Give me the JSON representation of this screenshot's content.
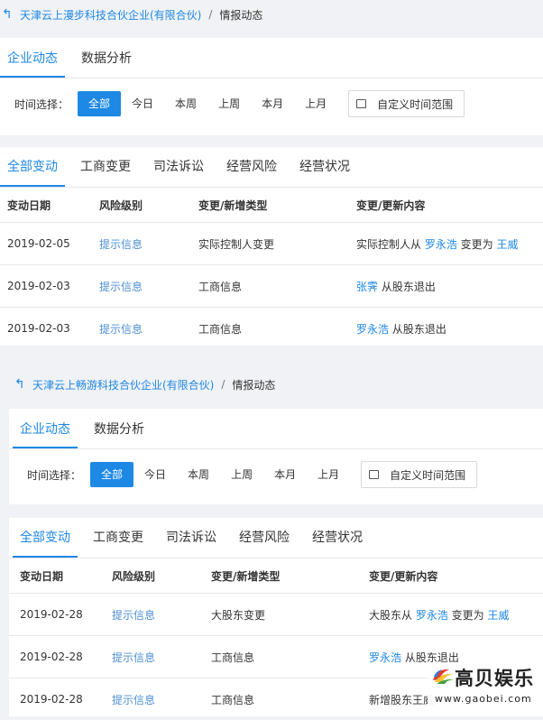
{
  "sections": [
    {
      "breadcrumb": {
        "company": "天津云上漫步科技合伙企业(有限合伙)",
        "separator": "/",
        "current": "情报动态"
      },
      "main_tabs": [
        {
          "label": "企业动态",
          "active": true
        },
        {
          "label": "数据分析",
          "active": false
        }
      ],
      "filter": {
        "label": "时间选择：",
        "options": [
          {
            "label": "全部",
            "active": true
          },
          {
            "label": "今日"
          },
          {
            "label": "本周"
          },
          {
            "label": "上周"
          },
          {
            "label": "本月"
          },
          {
            "label": "上月"
          }
        ],
        "custom_range": "自定义时间范围"
      },
      "sub_tabs": [
        {
          "label": "全部变动",
          "active": true
        },
        {
          "label": "工商变更"
        },
        {
          "label": "司法诉讼"
        },
        {
          "label": "经营风险"
        },
        {
          "label": "经营状况"
        }
      ],
      "table": {
        "headers": [
          "变动日期",
          "风险级别",
          "变更/新增类型",
          "变更/更新内容"
        ],
        "rows": [
          {
            "date": "2019-02-05",
            "risk": "提示信息",
            "type": "实际控制人变更",
            "content": [
              {
                "t": "实际控制人从 "
              },
              {
                "t": "罗永浩",
                "link": true
              },
              {
                "t": " 变更为 "
              },
              {
                "t": "王威",
                "link": true
              }
            ]
          },
          {
            "date": "2019-02-03",
            "risk": "提示信息",
            "type": "工商信息",
            "content": [
              {
                "t": "张霁",
                "link": true
              },
              {
                "t": " 从股东退出"
              }
            ]
          },
          {
            "date": "2019-02-03",
            "risk": "提示信息",
            "type": "工商信息",
            "content": [
              {
                "t": "罗永浩",
                "link": true
              },
              {
                "t": " 从股东退出"
              }
            ]
          }
        ]
      }
    },
    {
      "breadcrumb": {
        "company": "天津云上畅游科技合伙企业(有限合伙)",
        "separator": "/",
        "current": "情报动态"
      },
      "main_tabs": [
        {
          "label": "企业动态",
          "active": true
        },
        {
          "label": "数据分析",
          "active": false
        }
      ],
      "filter": {
        "label": "时间选择：",
        "options": [
          {
            "label": "全部",
            "active": true
          },
          {
            "label": "今日"
          },
          {
            "label": "本周"
          },
          {
            "label": "上周"
          },
          {
            "label": "本月"
          },
          {
            "label": "上月"
          }
        ],
        "custom_range": "自定义时间范围"
      },
      "sub_tabs": [
        {
          "label": "全部变动",
          "active": true
        },
        {
          "label": "工商变更"
        },
        {
          "label": "司法诉讼"
        },
        {
          "label": "经营风险"
        },
        {
          "label": "经营状况"
        }
      ],
      "table": {
        "headers": [
          "变动日期",
          "风险级别",
          "变更/新增类型",
          "变更/更新内容"
        ],
        "rows": [
          {
            "date": "2019-02-28",
            "risk": "提示信息",
            "type": "大股东变更",
            "content": [
              {
                "t": "大股东从 "
              },
              {
                "t": "罗永浩",
                "link": true
              },
              {
                "t": " 变更为 "
              },
              {
                "t": "王威",
                "link": true
              }
            ]
          },
          {
            "date": "2019-02-28",
            "risk": "提示信息",
            "type": "工商信息",
            "content": [
              {
                "t": "罗永浩",
                "link": true
              },
              {
                "t": " 从股东退出"
              }
            ]
          },
          {
            "date": "2019-02-28",
            "risk": "提示信息",
            "type": "工商信息",
            "content": [
              {
                "t": "新增股东王威"
              }
            ]
          }
        ]
      }
    }
  ],
  "watermark": {
    "brand": "高贝娱乐",
    "url": "www.gaobei.com"
  },
  "colors": {
    "accent": "#1e88e5",
    "risk": "#4e8fd4"
  }
}
